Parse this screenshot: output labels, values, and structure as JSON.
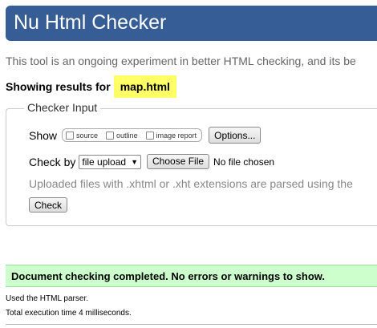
{
  "banner": {
    "title": "Nu Html Checker"
  },
  "intro": {
    "text": "This tool is an ongoing experiment in better HTML checking, and its be"
  },
  "showing": {
    "label": "Showing results for",
    "filename": "map.html"
  },
  "checker": {
    "legend": "Checker Input",
    "show_label": "Show",
    "options": [
      {
        "label": "source"
      },
      {
        "label": "outline"
      },
      {
        "label": "image report"
      }
    ],
    "options_button": "Options...",
    "check_by_label": "Check by",
    "select_value": "file upload",
    "choose_file_button": "Choose File",
    "no_file_text": "No file chosen",
    "uploaded_note": "Uploaded files with .xhtml or .xht extensions are parsed using the",
    "check_button": "Check"
  },
  "result": {
    "message": "Document checking completed. No errors or warnings to show.",
    "parser_text": "Used the HTML parser.",
    "execution_text": "Total execution time 4 milliseconds."
  },
  "colors": {
    "banner": "#365d95",
    "highlight": "#ffff66",
    "success_bg": "#ccffcc"
  }
}
